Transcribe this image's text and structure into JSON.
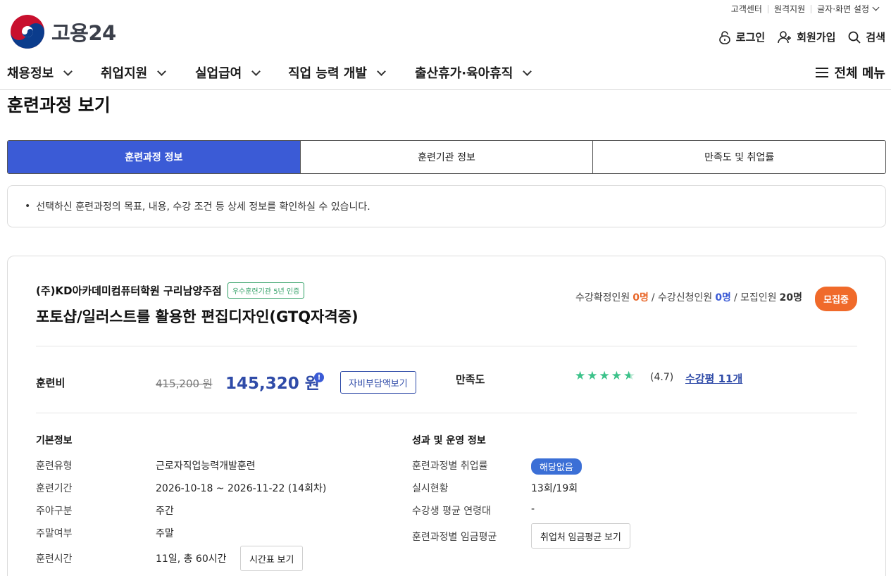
{
  "util": {
    "items": [
      "고객센터",
      "원격지원",
      "글자·화면 설정"
    ]
  },
  "logo": {
    "text": "고용24"
  },
  "actions": {
    "login": "로그인",
    "signup": "회원가입",
    "search": "검색"
  },
  "gnb": {
    "menus": [
      "채용정보",
      "취업지원",
      "실업급여",
      "직업 능력 개발",
      "출산휴가·육아휴직"
    ],
    "all_menu": "전체 메뉴"
  },
  "page_title": "훈련과정 보기",
  "tabs": [
    "훈련과정 정보",
    "훈련기관 정보",
    "만족도 및 취업률"
  ],
  "notice": "선택하신 훈련과정의 목표, 내용, 수강 조건 등 상세 정보를 확인하실 수 있습니다.",
  "course": {
    "institution": "(주)KD아카데미컴퓨터학원 구리남양주점",
    "cert_badge": "우수훈련기관 5년 인증",
    "title": "포토샵/일러스트를 활용한 편집디자인(GTQ자격증)",
    "confirmed_label": "수강확정인원",
    "confirmed": "0명",
    "applied_label": "/ 수강신청인원",
    "applied": "0명",
    "recruit_label": "/ 모집인원",
    "recruit": "20명",
    "status": "모집중"
  },
  "fee": {
    "label": "훈련비",
    "original": "415,200 원",
    "current": "145,320 원",
    "self_pay_button": "자비부담액보기"
  },
  "satisfaction": {
    "label": "만족도",
    "rating": 4.7,
    "score_text": "(4.7)",
    "reviews": "수강평 11개"
  },
  "basic": {
    "title": "기본정보",
    "rows": [
      {
        "label": "훈련유형",
        "value": "근로자직업능력개발훈련"
      },
      {
        "label": "훈련기간",
        "value": "2026-10-18 ~ 2026-11-22 (14회차)"
      },
      {
        "label": "주야구분",
        "value": "주간"
      },
      {
        "label": "주말여부",
        "value": "주말"
      },
      {
        "label": "훈련시간",
        "value": "11일, 총 60시간"
      }
    ],
    "timetable_button": "시간표 보기"
  },
  "perf": {
    "title": "성과 및 운영 정보",
    "rows": [
      {
        "label": "훈련과정별 취업률",
        "value": "해당없음"
      },
      {
        "label": "실시현황",
        "value": "13회/19회"
      },
      {
        "label": "수강생 평균 연령대",
        "value": "-"
      },
      {
        "label": "훈련과정별 임금평균",
        "value": "취업처 임금평균 보기"
      }
    ]
  },
  "colors": {
    "primary": "#3b5bd6",
    "orange": "#f06a2a",
    "green": "#3cc28a"
  }
}
